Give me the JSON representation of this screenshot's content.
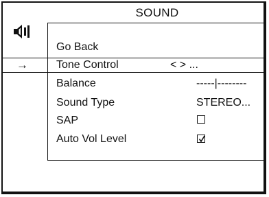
{
  "menu": {
    "title": "SOUND",
    "icon": "speaker-icon",
    "cursor_glyph": "→",
    "items": [
      {
        "label": "Go Back",
        "value": ""
      },
      {
        "label": "Tone Control",
        "value": "< > ...",
        "selected": true
      },
      {
        "label": "Balance",
        "value": "-----|--------"
      },
      {
        "label": "Sound Type",
        "value": "STEREO..."
      },
      {
        "label": "SAP",
        "checked": false
      },
      {
        "label": "Auto Vol Level",
        "checked": true
      }
    ]
  }
}
